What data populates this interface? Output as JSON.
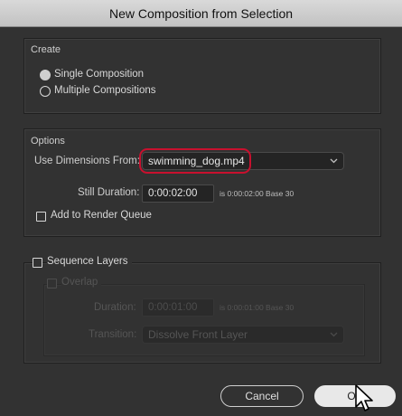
{
  "window": {
    "title": "New Composition from Selection"
  },
  "create": {
    "label": "Create",
    "options": [
      {
        "label": "Single Composition",
        "selected": true
      },
      {
        "label": "Multiple Compositions",
        "selected": false
      }
    ]
  },
  "options": {
    "label": "Options",
    "use_dimensions_label": "Use Dimensions From:",
    "use_dimensions_value": "swimming_dog.mp4",
    "still_duration_label": "Still Duration:",
    "still_duration_value": "0:00:02:00",
    "still_duration_note": "is 0:00:02:00  Base 30",
    "add_to_render_queue_label": "Add to Render Queue",
    "add_to_render_queue_checked": false
  },
  "sequence": {
    "label": "Sequence Layers",
    "checked": false,
    "overlap_label": "Overlap",
    "duration_label": "Duration:",
    "duration_value": "0:00:01:00",
    "duration_note": "is 0:00:01:00  Base 30",
    "transition_label": "Transition:",
    "transition_value": "Dissolve Front Layer"
  },
  "buttons": {
    "cancel": "Cancel",
    "ok": "OK"
  },
  "colors": {
    "highlight": "#c8102e",
    "background": "#323232"
  },
  "icons": {
    "dropdown": "chevron-down-icon",
    "pointer": "mouse-pointer-icon"
  }
}
